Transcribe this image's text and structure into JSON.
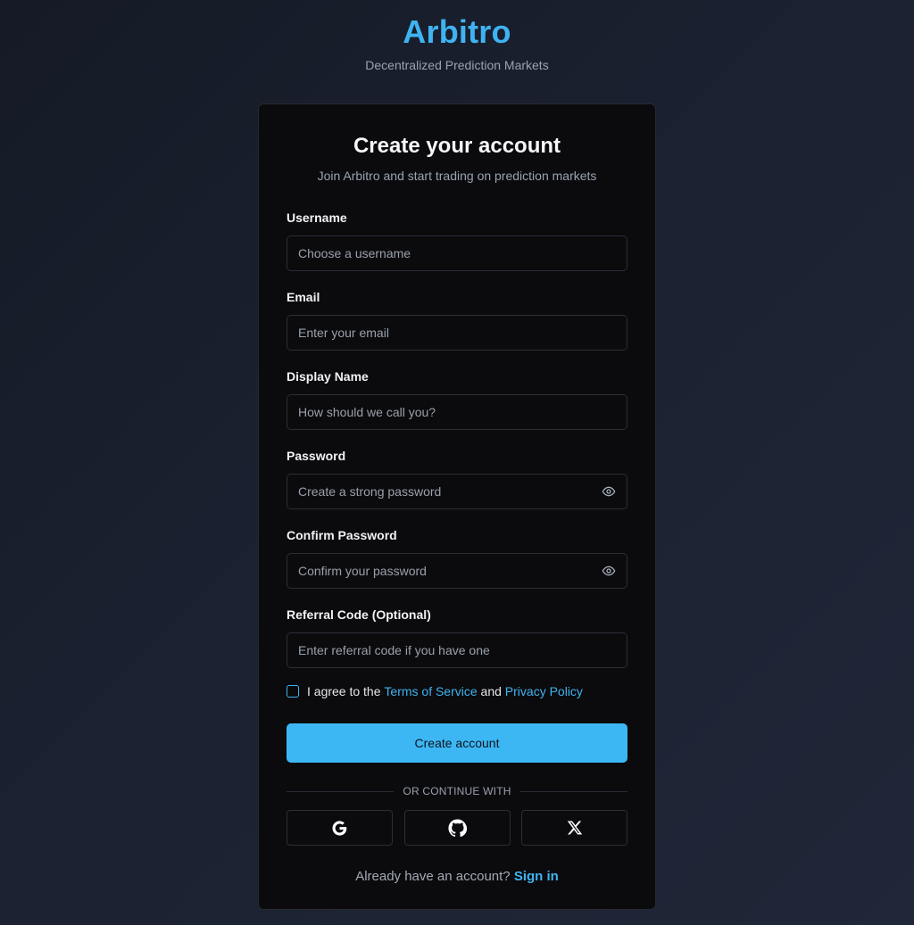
{
  "brand": {
    "title": "Arbitro",
    "subtitle": "Decentralized Prediction Markets"
  },
  "card": {
    "title": "Create your account",
    "subtitle": "Join Arbitro and start trading on prediction markets"
  },
  "fields": {
    "username": {
      "label": "Username",
      "placeholder": "Choose a username",
      "value": ""
    },
    "email": {
      "label": "Email",
      "placeholder": "Enter your email",
      "value": ""
    },
    "display_name": {
      "label": "Display Name",
      "placeholder": "How should we call you?",
      "value": ""
    },
    "password": {
      "label": "Password",
      "placeholder": "Create a strong password",
      "value": "",
      "toggle_icon": "eye-icon"
    },
    "confirm_password": {
      "label": "Confirm Password",
      "placeholder": "Confirm your password",
      "value": "",
      "toggle_icon": "eye-icon"
    },
    "referral": {
      "label": "Referral Code (Optional)",
      "placeholder": "Enter referral code if you have one",
      "value": ""
    }
  },
  "terms": {
    "checked": false,
    "prefix": "I agree to the",
    "terms_link": "Terms of Service",
    "conjunction": "and",
    "privacy_link": "Privacy Policy"
  },
  "submit": {
    "label": "Create account"
  },
  "divider": {
    "label": "OR CONTINUE WITH"
  },
  "social": [
    {
      "name": "google",
      "icon": "google-icon"
    },
    {
      "name": "github",
      "icon": "github-icon"
    },
    {
      "name": "x",
      "icon": "x-icon"
    }
  ],
  "footer": {
    "prompt": "Already have an account?",
    "link": "Sign in"
  },
  "colors": {
    "accent": "#3fb3f1",
    "button": "#3db7f3",
    "card_bg": "#0b0b0e",
    "page_bg": "#1b2130"
  }
}
